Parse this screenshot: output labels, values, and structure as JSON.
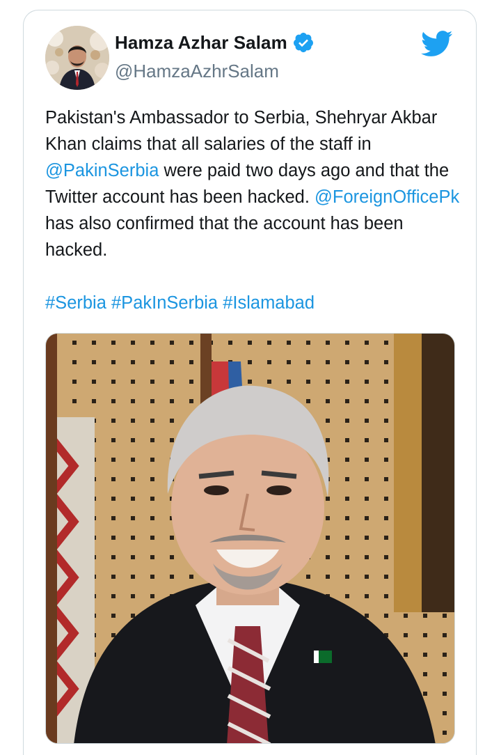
{
  "author": {
    "name": "Hamza Azhar Salam",
    "handle": "@HamzaAzhrSalam",
    "verified": true,
    "avatar_icon": "profile-photo"
  },
  "brand": {
    "icon": "twitter-bird-icon",
    "color": "#1da1f2"
  },
  "tweet": {
    "line1_text": "Pakistan's Ambassador to Serbia, Shehryar Akbar Khan claims that all salaries of the staff in ",
    "mention_1": "@PakinSerbia",
    "line1_tail": " were paid two days ago and that the Twitter account has been hacked.",
    "mention_2": "@ForeignOfficePk",
    "line2_tail": " has also confirmed that the account has been hacked.",
    "hashtag_1": "#Serbia",
    "hashtag_2": "#PakInSerbia",
    "hashtag_3": "#Islamabad"
  },
  "media": {
    "description_icon": "photo-of-man-in-suit",
    "type": "image"
  },
  "colors": {
    "text": "#14171a",
    "secondary": "#657786",
    "link": "#1b95e0",
    "border": "#cfd9de"
  }
}
